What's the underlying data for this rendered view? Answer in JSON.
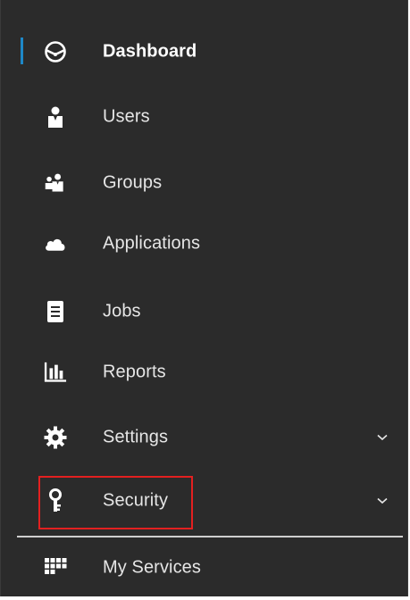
{
  "sidebar": {
    "items": [
      {
        "label": "Dashboard",
        "icon": "dashboard-icon",
        "active": true
      },
      {
        "label": "Users",
        "icon": "user-icon"
      },
      {
        "label": "Groups",
        "icon": "groups-icon"
      },
      {
        "label": "Applications",
        "icon": "cloud-icon"
      },
      {
        "label": "Jobs",
        "icon": "jobs-icon"
      },
      {
        "label": "Reports",
        "icon": "bar-chart-icon"
      },
      {
        "label": "Settings",
        "icon": "gear-icon",
        "expandable": true
      },
      {
        "label": "Security",
        "icon": "key-icon",
        "expandable": true,
        "highlighted": true
      },
      {
        "label": "My Services",
        "icon": "grid-icon"
      }
    ]
  },
  "colors": {
    "background": "#2b2b2b",
    "text": "#e6e6e6",
    "active_indicator": "#1e88c8",
    "highlight": "#e32020",
    "divider": "#cfcfcf"
  }
}
